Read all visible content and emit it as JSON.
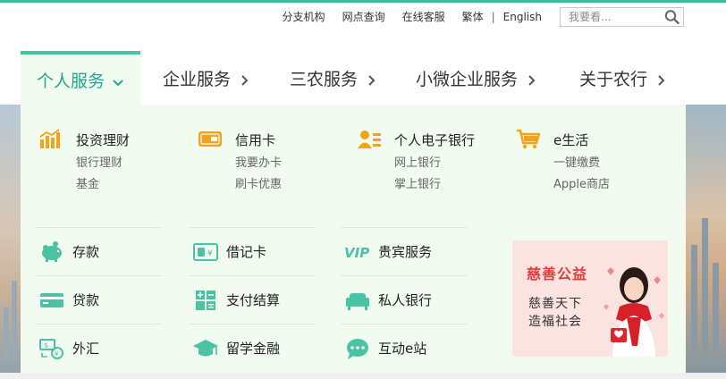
{
  "colors": {
    "accent": "#1fa88a",
    "brand_bar": "#2fbf9c",
    "icon_orange": "#f5a31a",
    "icon_teal": "#49c3a4",
    "panel_bg": "#f1fbf0"
  },
  "topbar": {
    "links": [
      "分支机构",
      "网点查询",
      "在线客服",
      "繁体",
      "English"
    ],
    "separator": "|",
    "search_placeholder": "我要看..."
  },
  "nav": {
    "items": [
      {
        "label": "个人服务",
        "active": true,
        "arrow": "chevron-down"
      },
      {
        "label": "企业服务",
        "arrow": "chevron-right"
      },
      {
        "label": "三农服务",
        "arrow": "chevron-right"
      },
      {
        "label": "小微企业服务",
        "arrow": "chevron-right"
      },
      {
        "label": "关于农行",
        "arrow": "chevron-right"
      }
    ]
  },
  "panel": {
    "categories": [
      {
        "title": "投资理财",
        "icon": "bar-chart-icon",
        "subs": [
          "银行理财",
          "基金"
        ]
      },
      {
        "title": "信用卡",
        "icon": "credit-card-icon",
        "subs": [
          "我要办卡",
          "刷卡优惠"
        ]
      },
      {
        "title": "个人电子银行",
        "icon": "user-list-icon",
        "subs": [
          "网上银行",
          "掌上银行"
        ]
      },
      {
        "title": "e生活",
        "icon": "shopping-cart-icon",
        "subs": [
          "一键缴费",
          "Apple商店"
        ]
      }
    ],
    "services": [
      {
        "label": "存款",
        "icon": "piggy-bank-icon"
      },
      {
        "label": "借记卡",
        "icon": "debit-card-icon"
      },
      {
        "label": "贵宾服务",
        "icon": "vip-icon",
        "badge": "VIP"
      },
      {
        "label": "贷款",
        "icon": "loan-card-icon"
      },
      {
        "label": "支付结算",
        "icon": "calculator-icon"
      },
      {
        "label": "私人银行",
        "icon": "sofa-icon"
      },
      {
        "label": "外汇",
        "icon": "exchange-icon"
      },
      {
        "label": "留学金融",
        "icon": "graduation-cap-icon"
      },
      {
        "label": "互动e站",
        "icon": "chat-bubble-icon"
      }
    ],
    "promo": {
      "line1": "慈善公益",
      "line2": "慈善天下",
      "line3": "造福社会"
    }
  }
}
